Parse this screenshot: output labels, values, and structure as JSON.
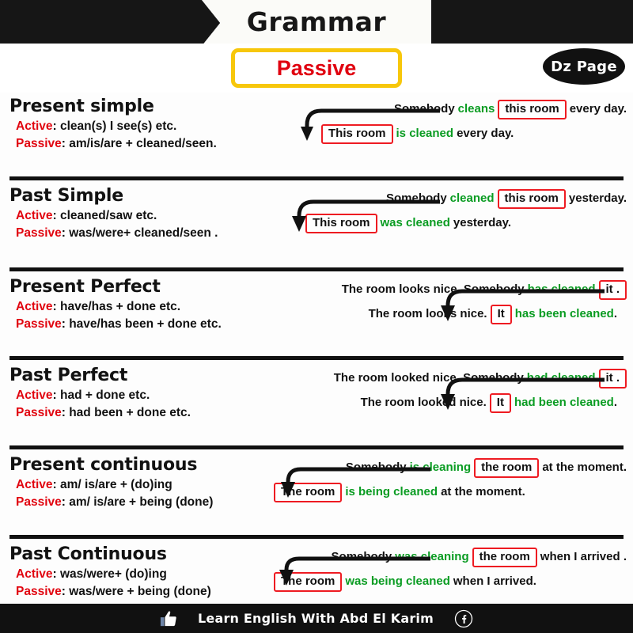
{
  "header": {
    "banner_title": "Grammar",
    "subtitle": "Passive",
    "badge": "Dz Page",
    "accent_yellow": "#f7c70b",
    "accent_red": "#e0000f",
    "accent_green": "#0a9c22",
    "box_red": "#ee1b22",
    "bar_black": "#161616"
  },
  "sections": [
    {
      "title": "Present simple",
      "active_label": "Active",
      "active_value": ": clean(s) I see(s) etc.",
      "passive_label": "Passive",
      "passive_value": ": am/is/are + cleaned/seen.",
      "example_active": {
        "pre": "Somebody",
        "verb": "cleans",
        "boxed": "this room",
        "post": "every day."
      },
      "example_passive": {
        "boxed": "This room",
        "verb": "is cleaned",
        "post": "every day."
      }
    },
    {
      "title": "Past Simple",
      "active_label": "Active",
      "active_value": ": cleaned/saw etc.",
      "passive_label": "Passive",
      "passive_value": ": was/were+ cleaned/seen .",
      "example_active": {
        "pre": "Somebody",
        "verb": "cleaned",
        "boxed": "this room",
        "post": "yesterday."
      },
      "example_passive": {
        "boxed": "This room",
        "verb": "was cleaned",
        "post": "yesterday."
      }
    },
    {
      "title": "Present Perfect",
      "active_label": "Active",
      "active_value": ": have/has + done etc.",
      "passive_label": "Passive",
      "passive_value": ": have/has been + done etc.",
      "example_active": {
        "pre": "The room looks nice. Somebody",
        "verb": "has cleaned",
        "boxed": "it .",
        "post": ""
      },
      "example_passive": {
        "pre": "The room looks nice.",
        "boxed": "It",
        "verb": "has been cleaned",
        "post": "."
      }
    },
    {
      "title": "Past Perfect",
      "active_label": "Active",
      "active_value": ": had + done etc.",
      "passive_label": "Passive",
      "passive_value": ": had been + done etc.",
      "example_active": {
        "pre": "The room looked nice. Somebody",
        "verb": "had cleaned",
        "boxed": "it .",
        "post": ""
      },
      "example_passive": {
        "pre": "The room looked nice.",
        "boxed": "It",
        "verb": "had been cleaned",
        "post": "."
      }
    },
    {
      "title": "Present continuous",
      "active_label": "Active",
      "active_value": ": am/ is/are + (do)ing",
      "passive_label": "Passive",
      "passive_value": ": am/ is/are + being (done)",
      "example_active": {
        "pre": "Somebody",
        "verb": "is cleaning",
        "boxed": "the room",
        "post": "at the moment."
      },
      "example_passive": {
        "boxed": "The room",
        "verb": "is being cleaned",
        "post": "at the moment."
      }
    },
    {
      "title": "Past Continuous",
      "active_label": "Active",
      "active_value": ": was/were+ (do)ing",
      "passive_label": "Passive",
      "passive_value": ": was/were + being (done)",
      "example_active": {
        "pre": "Somebody",
        "verb": "was cleaning",
        "boxed": "the room",
        "post": "when I arrived ."
      },
      "example_passive": {
        "boxed": "The room",
        "verb": "was being cleaned",
        "post": "when I arrived."
      }
    }
  ],
  "footer": {
    "text": "Learn English With Abd El Karim",
    "thumb_icon": "thumbs-up-icon",
    "facebook_icon": "facebook-icon"
  }
}
